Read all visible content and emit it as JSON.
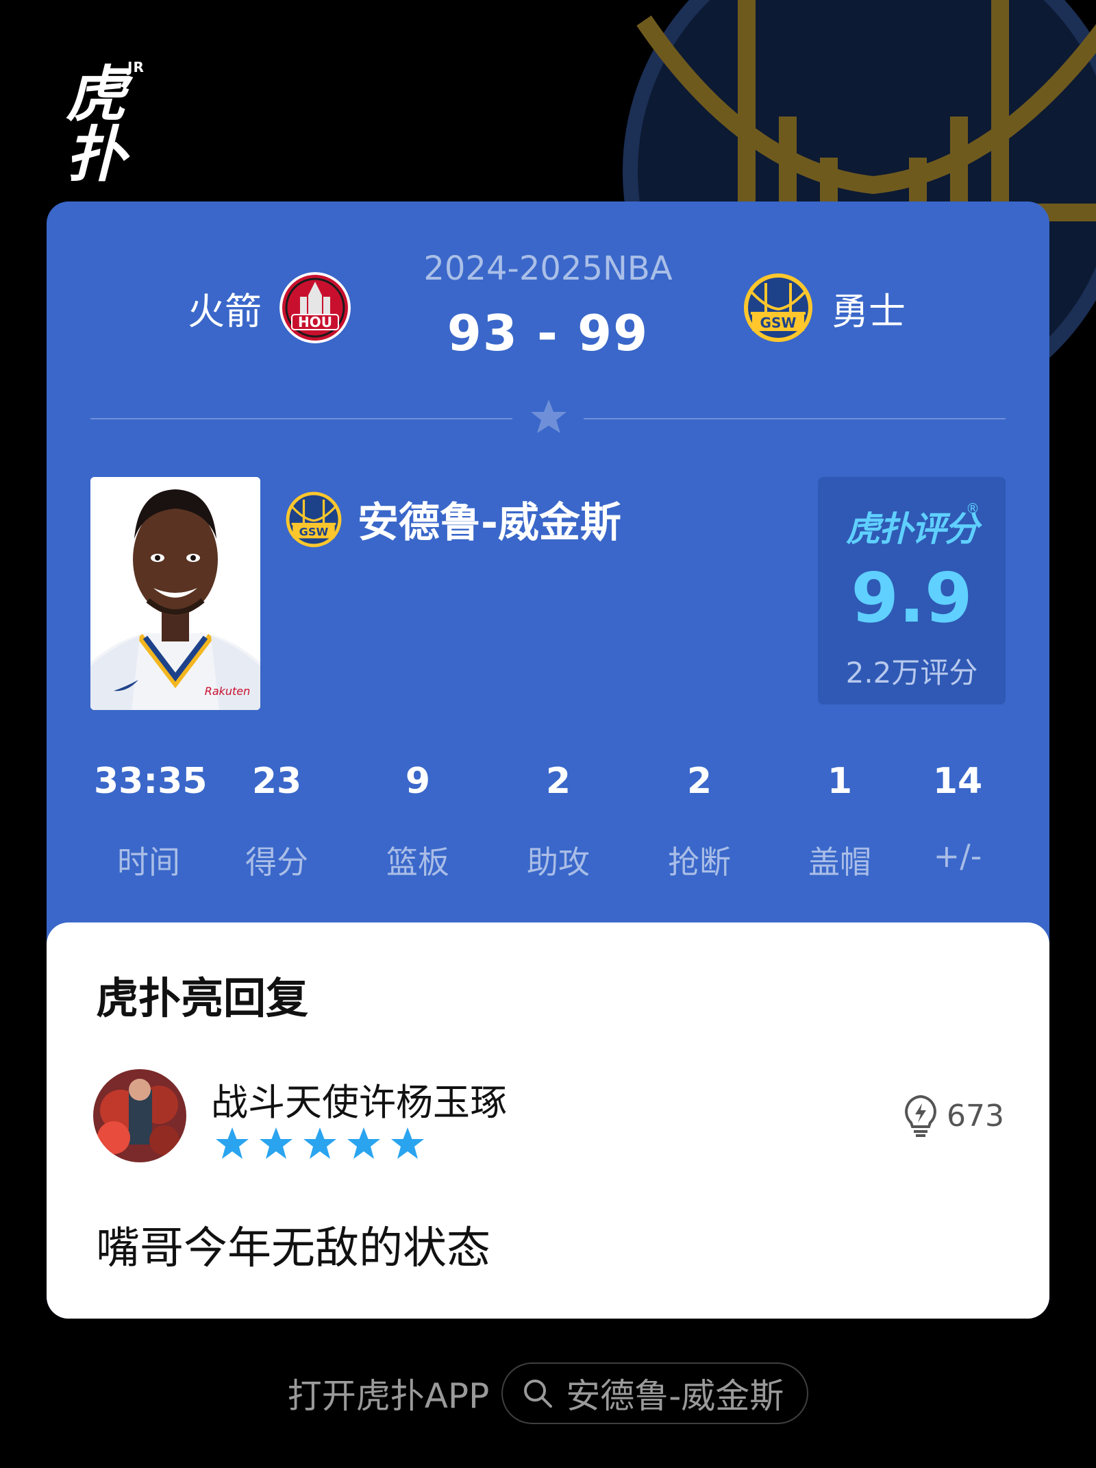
{
  "brand": {
    "logo_text": "虎扑",
    "logo_badge": "JR"
  },
  "game": {
    "season": "2024-2025NBA",
    "score": "93 - 99",
    "home_team": {
      "name": "火箭",
      "abbr": "HOU",
      "color": "#c8102e"
    },
    "away_team": {
      "name": "勇士",
      "abbr": "GSW",
      "color": "#1d428a",
      "accent": "#ffc72c"
    }
  },
  "player": {
    "name": "安德鲁-威金斯",
    "team_abbr": "GSW",
    "jersey_sponsor": "Rakuten"
  },
  "rating": {
    "label": "虎扑评分",
    "registered_mark": "®",
    "value": "9.9",
    "count": "2.2万评分"
  },
  "stats": [
    {
      "value": "33:35",
      "label": "时间"
    },
    {
      "value": "23",
      "label": "得分"
    },
    {
      "value": "9",
      "label": "篮板"
    },
    {
      "value": "2",
      "label": "助攻"
    },
    {
      "value": "2",
      "label": "抢断"
    },
    {
      "value": "1",
      "label": "盖帽"
    },
    {
      "value": "14",
      "label": "+/-"
    }
  ],
  "reply": {
    "title": "虎扑亮回复",
    "username": "战斗天使许杨玉琢",
    "star_rating": 5,
    "likes": "673",
    "comment": "嘴哥今年无敌的状态"
  },
  "cta": {
    "open_app": "打开虎扑APP",
    "search_query": "安德鲁-威金斯",
    "search_icon": "search-icon"
  },
  "colors": {
    "card_blue": "#3a67c9",
    "rating_cyan": "#5fd0ff",
    "star_blue": "#2aa4ef"
  }
}
